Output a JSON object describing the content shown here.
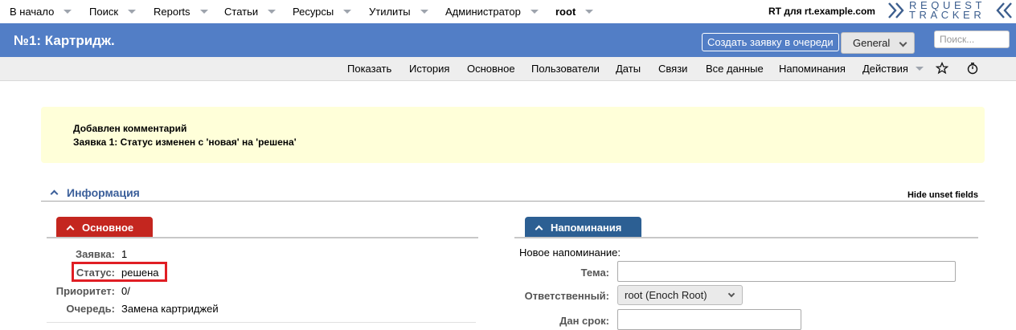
{
  "topnav": {
    "items": [
      "В начало",
      "Поиск",
      "Reports",
      "Статьи",
      "Ресурсы",
      "Утилиты",
      "Администратор",
      "root"
    ],
    "rt_for": "RT для rt.example.com",
    "logo_line1": "REQUEST",
    "logo_line2": "TRACKER"
  },
  "titlebar": {
    "title": "№1: Картридж.",
    "create_button": "Создать заявку в очереди",
    "queue_selected": "General",
    "search_placeholder": "Поиск..."
  },
  "pagemenu": {
    "items": [
      "Показать",
      "История",
      "Основное",
      "Пользователи",
      "Даты",
      "Связи",
      "Все данные",
      "Напоминания",
      "Действия"
    ],
    "icons": [
      "star-icon",
      "timer-icon"
    ]
  },
  "results": {
    "line1": "Добавлен комментарий",
    "line2": "Заявка 1: Статус изменен с 'новая' на 'решена'"
  },
  "info": {
    "title": "Информация",
    "hide_unset": "Hide unset fields"
  },
  "basics": {
    "title": "Основное",
    "rows": [
      {
        "label": "Заявка:",
        "value": "1"
      },
      {
        "label": "Статус:",
        "value": "решена"
      },
      {
        "label": "Приоритет:",
        "value": "0/"
      },
      {
        "label": "Очередь:",
        "value": "Замена картриджей"
      }
    ]
  },
  "reminders": {
    "title": "Напоминания",
    "new_label": "Новое напоминание:",
    "subject_label": "Тема:",
    "owner_label": "Ответственный:",
    "owner_value": "root (Enoch Root)",
    "due_label": "Дан срок:"
  },
  "colors": {
    "title_bar": "#527ec6",
    "basics_tab": "#c4261f",
    "reminders_tab": "#2c5f93",
    "results_bg": "#ffffd9",
    "highlight": "#e01e24"
  }
}
